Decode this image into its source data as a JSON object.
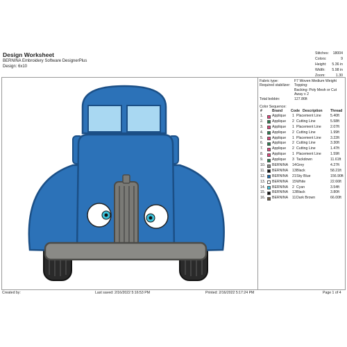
{
  "header": {
    "title": "Design Worksheet",
    "software": "BERNINA Embroidery Software DesignerPlus",
    "design": "Design:  6x10"
  },
  "stats": [
    {
      "label": "Stitches:",
      "value": "18004"
    },
    {
      "label": "Colors:",
      "value": "9"
    },
    {
      "label": "Height:",
      "value": "5.36 in"
    },
    {
      "label": "Width:",
      "value": "5.98 in"
    },
    {
      "label": "Zoom:",
      "value": "1.30"
    }
  ],
  "info": {
    "fabric_label": "Fabric type:",
    "fabric_value": "F7 Woven Medium Weight",
    "stabilizer_label": "Required stabilizer:",
    "stabilizer_lines": [
      "Topping:",
      "Backing: Poly Mesh or Cut",
      "Away x 2"
    ],
    "bobbin_label": "Total bobbin:",
    "bobbin_value": "127.86ft"
  },
  "sequence": {
    "title": "Color Sequence:",
    "headers": {
      "num": "#",
      "brand": "Brand",
      "code": "Code",
      "desc": "Description",
      "thread": "Thread"
    },
    "rows": [
      {
        "num": "1.",
        "color": "#e0457b",
        "brand": "Applique",
        "code": "1",
        "desc": "Placement Line",
        "thread": "5.40ft"
      },
      {
        "num": "2.",
        "color": "#2a7d4f",
        "brand": "Applique",
        "code": "2",
        "desc": "Cutting Line",
        "thread": "5.58ft"
      },
      {
        "num": "3.",
        "color": "#e0457b",
        "brand": "Applique",
        "code": "1",
        "desc": "Placement Line",
        "thread": "2.07ft"
      },
      {
        "num": "4.",
        "color": "#2a7d4f",
        "brand": "Applique",
        "code": "2",
        "desc": "Cutting Line",
        "thread": "1.99ft"
      },
      {
        "num": "5.",
        "color": "#e0457b",
        "brand": "Applique",
        "code": "1",
        "desc": "Placement Line",
        "thread": "3.22ft"
      },
      {
        "num": "6.",
        "color": "#2a7d4f",
        "brand": "Applique",
        "code": "2",
        "desc": "Cutting Line",
        "thread": "3.30ft"
      },
      {
        "num": "7.",
        "color": "#e0457b",
        "brand": "Applique",
        "code": "2",
        "desc": "Cutting Line",
        "thread": "1.47ft"
      },
      {
        "num": "8.",
        "color": "#e0457b",
        "brand": "Applique",
        "code": "1",
        "desc": "Placement Line",
        "thread": "1.59ft"
      },
      {
        "num": "9.",
        "color": "#2a7d4f",
        "brand": "Applique",
        "code": "3",
        "desc": "Tackdown",
        "thread": "11.61ft"
      },
      {
        "num": "10.",
        "color": "#8a8a86",
        "brand": "BERNINA",
        "code": "14",
        "desc": "Grey",
        "thread": "4.27ft"
      },
      {
        "num": "11.",
        "color": "#151515",
        "brand": "BERNINA",
        "code": "13",
        "desc": "Black",
        "thread": "58.21ft"
      },
      {
        "num": "12.",
        "color": "#1f6fb4",
        "brand": "BERNINA",
        "code": "21",
        "desc": "Sky Blue",
        "thread": "156.90ft"
      },
      {
        "num": "13.",
        "color": "#ffffff",
        "brand": "BERNINA",
        "code": "15",
        "desc": "White",
        "thread": "22.66ft"
      },
      {
        "num": "14.",
        "color": "#3cc3dc",
        "brand": "BERNINA",
        "code": "2",
        "desc": "Cyan",
        "thread": "3.54ft"
      },
      {
        "num": "15.",
        "color": "#151515",
        "brand": "BERNINA",
        "code": "13",
        "desc": "Black",
        "thread": "3.80ft"
      },
      {
        "num": "16.",
        "color": "#6e5e48",
        "brand": "BERNINA",
        "code": "11",
        "desc": "Dark Brown",
        "thread": "66.00ft"
      }
    ]
  },
  "footer": {
    "created": "Created by:",
    "saved": "Last saved:  2/16/2022 5:16:53 PM",
    "printed": "Printed:  2/16/2022 5:17:24 PM",
    "page": "Page 1 of 4"
  }
}
